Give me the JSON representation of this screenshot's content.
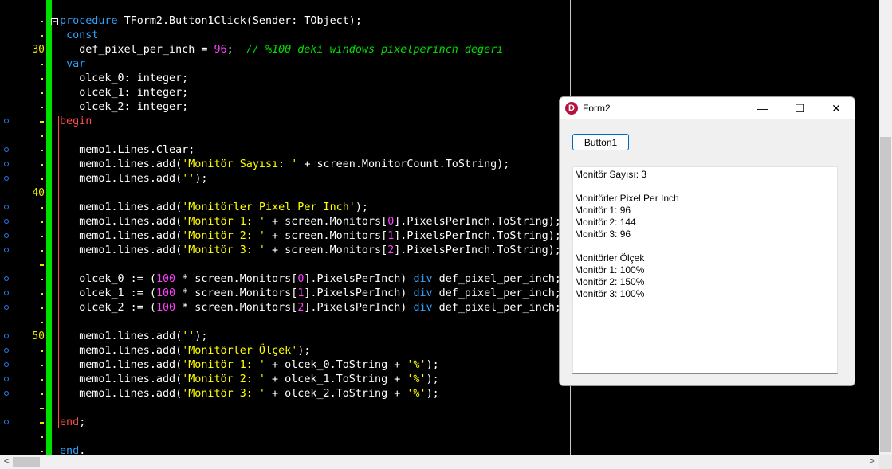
{
  "editor": {
    "line_numbers": {
      "l30": "30",
      "l40": "40",
      "l50": "50"
    },
    "code": {
      "l01_kw": "procedure",
      "l01_rest": " TForm2.Button1Click(Sender: TObject);",
      "l02_kw": "const",
      "l03_a": "def_pixel_per_inch = ",
      "l03_num": "96",
      "l03_b": ";  ",
      "l03_comment": "// %100 deki windows pixelperinch değeri",
      "l04_kw": "var",
      "l05": "olcek_0: integer;",
      "l06": "olcek_1: integer;",
      "l07": "olcek_2: integer;",
      "l08_kw": "begin",
      "l10": "memo1.Lines.Clear;",
      "l11_a": "memo1.lines.add(",
      "l11_str": "'Monitör Sayısı: '",
      "l11_b": " + screen.MonitorCount.ToString);",
      "l12_a": "memo1.lines.add(",
      "l12_str": "''",
      "l12_b": ");",
      "l14_a": "memo1.lines.add(",
      "l14_str": "'Monitörler Pixel Per Inch'",
      "l14_b": ");",
      "l15_a": "memo1.lines.add(",
      "l15_str": "'Monitör 1: '",
      "l15_b": " + screen.Monitors[",
      "l15_num": "0",
      "l15_c": "].PixelsPerInch.ToString);",
      "l16_a": "memo1.lines.add(",
      "l16_str": "'Monitör 2: '",
      "l16_b": " + screen.Monitors[",
      "l16_num": "1",
      "l16_c": "].PixelsPerInch.ToString);",
      "l17_a": "memo1.lines.add(",
      "l17_str": "'Monitör 3: '",
      "l17_b": " + screen.Monitors[",
      "l17_num": "2",
      "l17_c": "].PixelsPerInch.ToString);",
      "l19_a": "olcek_0 := (",
      "l19_num1": "100",
      "l19_b": " * screen.Monitors[",
      "l19_num2": "0",
      "l19_c": "].PixelsPerInch) ",
      "l19_kw": "div",
      "l19_d": " def_pixel_per_inch;",
      "l20_a": "olcek_1 := (",
      "l20_num1": "100",
      "l20_b": " * screen.Monitors[",
      "l20_num2": "1",
      "l20_c": "].PixelsPerInch) ",
      "l20_kw": "div",
      "l20_d": " def_pixel_per_inch;",
      "l21_a": "olcek_2 := (",
      "l21_num1": "100",
      "l21_b": " * screen.Monitors[",
      "l21_num2": "2",
      "l21_c": "].PixelsPerInch) ",
      "l21_kw": "div",
      "l21_d": " def_pixel_per_inch;",
      "l23_a": "memo1.lines.add(",
      "l23_str": "''",
      "l23_b": ");",
      "l24_a": "memo1.lines.add(",
      "l24_str": "'Monitörler Ölçek'",
      "l24_b": ");",
      "l25_a": "memo1.lines.add(",
      "l25_str": "'Monitör 1: '",
      "l25_b": " + olcek_0.ToString + ",
      "l25_str2": "'%'",
      "l25_c": ");",
      "l26_a": "memo1.lines.add(",
      "l26_str": "'Monitör 2: '",
      "l26_b": " + olcek_1.ToString + ",
      "l26_str2": "'%'",
      "l26_c": ");",
      "l27_a": "memo1.lines.add(",
      "l27_str": "'Monitör 3: '",
      "l27_b": " + olcek_2.ToString + ",
      "l27_str2": "'%'",
      "l27_c": ");",
      "l29_kw": "end",
      "l29_rest": ";",
      "l31_kw": "end",
      "l31_rest": "."
    }
  },
  "form2": {
    "title": "Form2",
    "icon_letter": "D",
    "minimize": "—",
    "maximize": "☐",
    "close": "✕",
    "button1_label": "Button1",
    "memo_lines": [
      "Monitör Sayısı: 3",
      "",
      "Monitörler Pixel Per Inch",
      "Monitör 1: 96",
      "Monitör 2: 144",
      "Monitör 3: 96",
      "",
      "Monitörler Ölçek",
      "Monitör 1: 100%",
      "Monitör 2: 150%",
      "Monitör 3: 100%"
    ]
  },
  "scrollbars": {
    "left_arrow": "<",
    "right_arrow": ">",
    "up_arrow": "▲",
    "down_arrow": "▼"
  },
  "colors": {
    "keyword": "#2ea3ff",
    "string": "#ffff00",
    "number": "#ff40ff",
    "comment": "#00e000",
    "begin_end": "#ff4d4d"
  }
}
